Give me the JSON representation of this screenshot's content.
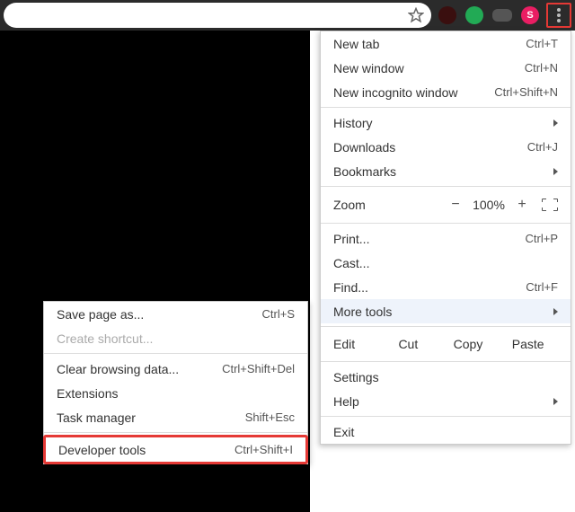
{
  "toolbar": {
    "avatar_letter": "S"
  },
  "menu": {
    "new_tab": {
      "label": "New tab",
      "shortcut": "Ctrl+T"
    },
    "new_window": {
      "label": "New window",
      "shortcut": "Ctrl+N"
    },
    "new_incognito": {
      "label": "New incognito window",
      "shortcut": "Ctrl+Shift+N"
    },
    "history": {
      "label": "History"
    },
    "downloads": {
      "label": "Downloads",
      "shortcut": "Ctrl+J"
    },
    "bookmarks": {
      "label": "Bookmarks"
    },
    "zoom": {
      "label": "Zoom",
      "minus": "−",
      "value": "100%",
      "plus": "+"
    },
    "print": {
      "label": "Print...",
      "shortcut": "Ctrl+P"
    },
    "cast": {
      "label": "Cast..."
    },
    "find": {
      "label": "Find...",
      "shortcut": "Ctrl+F"
    },
    "more_tools": {
      "label": "More tools"
    },
    "edit": {
      "label": "Edit",
      "cut": "Cut",
      "copy": "Copy",
      "paste": "Paste"
    },
    "settings": {
      "label": "Settings"
    },
    "help": {
      "label": "Help"
    },
    "exit": {
      "label": "Exit"
    }
  },
  "submenu": {
    "save_page": {
      "label": "Save page as...",
      "shortcut": "Ctrl+S"
    },
    "create_shortcut": {
      "label": "Create shortcut..."
    },
    "clear_browsing": {
      "label": "Clear browsing data...",
      "shortcut": "Ctrl+Shift+Del"
    },
    "extensions": {
      "label": "Extensions"
    },
    "task_manager": {
      "label": "Task manager",
      "shortcut": "Shift+Esc"
    },
    "developer_tools": {
      "label": "Developer tools",
      "shortcut": "Ctrl+Shift+I"
    }
  }
}
